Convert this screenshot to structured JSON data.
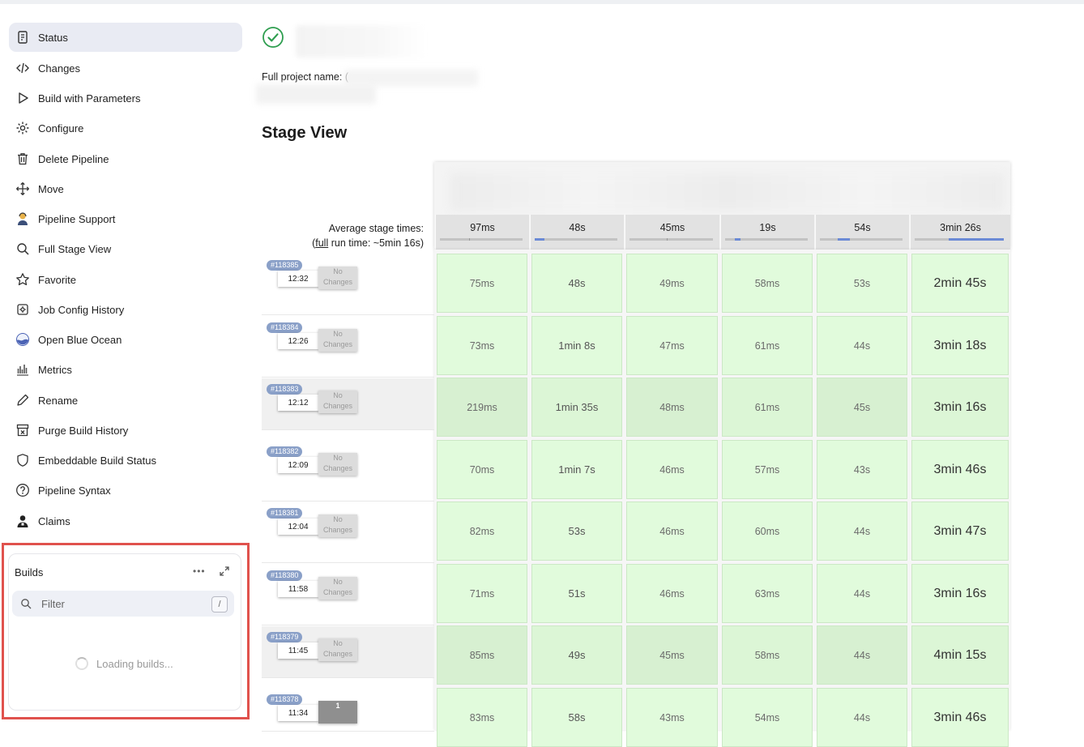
{
  "sidebar": {
    "items": [
      {
        "label": "Status",
        "icon": "document-icon"
      },
      {
        "label": "Changes",
        "icon": "code-icon"
      },
      {
        "label": "Build with Parameters",
        "icon": "play-icon"
      },
      {
        "label": "Configure",
        "icon": "gear-icon"
      },
      {
        "label": "Delete Pipeline",
        "icon": "trash-icon"
      },
      {
        "label": "Move",
        "icon": "move-arrows-icon"
      },
      {
        "label": "Pipeline Support",
        "icon": "support-person-icon"
      },
      {
        "label": "Full Stage View",
        "icon": "search-icon"
      },
      {
        "label": "Favorite",
        "icon": "star-icon"
      },
      {
        "label": "Job Config History",
        "icon": "config-history-icon"
      },
      {
        "label": "Open Blue Ocean",
        "icon": "blue-ocean-icon"
      },
      {
        "label": "Metrics",
        "icon": "bar-chart-icon"
      },
      {
        "label": "Rename",
        "icon": "pencil-icon"
      },
      {
        "label": "Purge Build History",
        "icon": "purge-box-icon"
      },
      {
        "label": "Embeddable Build Status",
        "icon": "shield-icon"
      },
      {
        "label": "Pipeline Syntax",
        "icon": "question-circle-icon"
      },
      {
        "label": "Claims",
        "icon": "claim-person-icon"
      }
    ]
  },
  "builds": {
    "title": "Builds",
    "more": "•••",
    "filter_placeholder": "Filter",
    "filter_shortcut": "/",
    "loading": "Loading builds..."
  },
  "project": {
    "full_name_label": "Full project name: ("
  },
  "stage_view": {
    "heading": "Stage View",
    "avg_label_line1": "Average stage times:",
    "avg_full_link": "full",
    "avg_label_line2_rest": " run time: ~5min 16s)",
    "avg_open_paren": "(",
    "avg_times": [
      "97ms",
      "48s",
      "45ms",
      "19s",
      "54s",
      "3min 26s"
    ],
    "avg_progress_fraction": [
      0.0,
      0.12,
      0.0,
      0.07,
      0.14,
      0.62
    ],
    "no_changes_line1": "No",
    "no_changes_line2": "Changes",
    "runs": [
      {
        "id": "#118385",
        "time": "12:32",
        "changes": "No Changes",
        "stages": [
          "75ms",
          "48s",
          "49ms",
          "58ms",
          "53s",
          "2min 45s"
        ]
      },
      {
        "id": "#118384",
        "time": "12:26",
        "changes": "No Changes",
        "stages": [
          "73ms",
          "1min 8s",
          "47ms",
          "61ms",
          "44s",
          "3min 18s"
        ]
      },
      {
        "id": "#118383",
        "time": "12:12",
        "changes": "No Changes",
        "stages": [
          "219ms",
          "1min 35s",
          "48ms",
          "61ms",
          "45s",
          "3min 16s"
        ]
      },
      {
        "id": "#118382",
        "time": "12:09",
        "changes": "No Changes",
        "stages": [
          "70ms",
          "1min 7s",
          "46ms",
          "57ms",
          "43s",
          "3min 46s"
        ]
      },
      {
        "id": "#118381",
        "time": "12:04",
        "changes": "No Changes",
        "stages": [
          "82ms",
          "53s",
          "46ms",
          "60ms",
          "44s",
          "3min 47s"
        ]
      },
      {
        "id": "#118380",
        "time": "11:58",
        "changes": "No Changes",
        "stages": [
          "71ms",
          "51s",
          "46ms",
          "63ms",
          "44s",
          "3min 16s"
        ]
      },
      {
        "id": "#118379",
        "time": "11:45",
        "changes": "No Changes",
        "stages": [
          "85ms",
          "49s",
          "45ms",
          "58ms",
          "44s",
          "4min 15s"
        ]
      },
      {
        "id": "#118378",
        "time": "11:34",
        "changes": "1",
        "stages": [
          "83ms",
          "58s",
          "43ms",
          "54ms",
          "44s",
          "3min 46s"
        ]
      }
    ]
  },
  "colors": {
    "success": "#2e9e4f",
    "cell_green": "#e1fbdc",
    "cell_green_dark": "#d7f0d1",
    "badge": "#8aa0c8",
    "highlight_border": "#e0524d",
    "progress_fill": "#6b8ad6"
  }
}
